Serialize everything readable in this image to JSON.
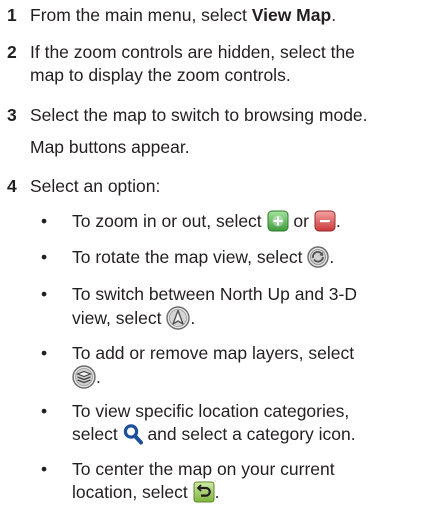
{
  "steps": [
    {
      "number": "1",
      "before": "From the main menu, select ",
      "bold": "View Map",
      "after": "."
    },
    {
      "number": "2",
      "line1": "If the zoom controls are hidden, select the",
      "line2": "map to display the zoom controls."
    },
    {
      "number": "3",
      "line1": "Select the map to switch to browsing mode.",
      "line2": "Map buttons appear."
    },
    {
      "number": "4",
      "text": "Select an option:"
    }
  ],
  "bullets": [
    {
      "before": "To zoom in or out, select ",
      "middle": " or ",
      "after": ".",
      "icons": [
        "zoom-in-icon",
        "zoom-out-icon"
      ]
    },
    {
      "before": "To rotate the map view, select ",
      "after": ".",
      "icons": [
        "rotate-icon"
      ]
    },
    {
      "line1": "To switch between North Up and 3-D",
      "line2_before": "view, select ",
      "after": ".",
      "icons": [
        "north-up-icon"
      ]
    },
    {
      "line1": "To add or remove map layers, select",
      "after": ".",
      "icons": [
        "map-layers-icon"
      ]
    },
    {
      "line1": "To view specific location categories,",
      "line2_before": "select ",
      "line2_after": " and select a category icon.",
      "icons": [
        "search-icon"
      ]
    },
    {
      "line1": "To center the map on your current",
      "line2_before": "location, select ",
      "after": ".",
      "icons": [
        "back-icon"
      ]
    }
  ],
  "bullet_symbol": "•",
  "colors": {
    "text": "#231f20",
    "zoom_button": "#4caf50",
    "zoom_out_button": "#e05a5a",
    "icon_outline": "#6b6b6b",
    "icon_fill": "#e6e6e6",
    "search_icon": "#1c4f9c",
    "back_button": "#8bc34a"
  }
}
